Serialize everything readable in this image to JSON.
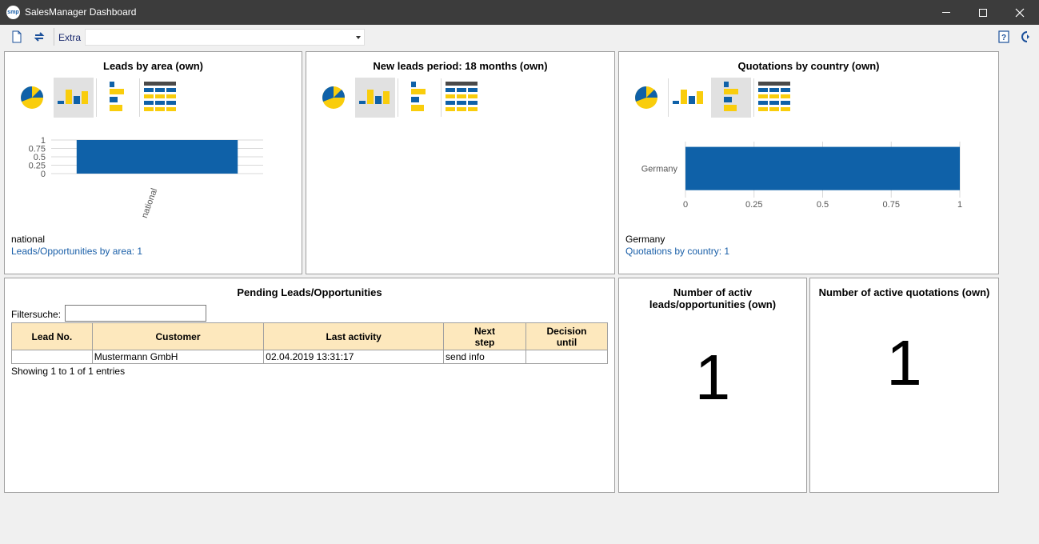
{
  "window": {
    "title": "SalesManager Dashboard",
    "app_icon_text": "smp"
  },
  "toolbar": {
    "extra_label": "Extra",
    "extra_value": ""
  },
  "panels": {
    "leads_by_area": {
      "title": "Leads by area (own)",
      "summary_label": "national",
      "summary_link": "Leads/Opportunities by area: 1"
    },
    "new_leads_period": {
      "title": "New leads period: 18 months (own)"
    },
    "quotations_by_country": {
      "title": "Quotations by country (own)",
      "summary_label": "Germany",
      "summary_link": "Quotations by country: 1"
    },
    "pending_leads": {
      "title": "Pending Leads/Opportunities",
      "filter_label": "Filtersuche:",
      "filter_value": "",
      "columns": [
        "Lead No.",
        "Customer",
        "Last activity",
        "Next step",
        "Decision until"
      ],
      "rows": [
        [
          "",
          "Mustermann GmbH",
          "02.04.2019 13:31:17",
          "send info",
          ""
        ]
      ],
      "showing": "Showing 1 to 1 of 1 entries"
    },
    "active_leads": {
      "title_line1": "Number of activ",
      "title_line2": "leads/opportunities (own)",
      "value": "1"
    },
    "active_quotations": {
      "title": "Number of active quotations (own)",
      "value": "1"
    }
  },
  "colors": {
    "blue": "#0f61a8",
    "yellow": "#f9cd0c",
    "dark": "#4a4a4a",
    "header_bg": "#fde8bd"
  },
  "chart_data": [
    {
      "type": "bar",
      "title": "Leads by area (own)",
      "categories": [
        "national"
      ],
      "values": [
        1
      ],
      "ylim": [
        0,
        1
      ],
      "yticks": [
        "1",
        "0.75",
        "0.5",
        "0.25",
        "0"
      ]
    },
    {
      "type": "bar",
      "orientation": "horizontal",
      "title": "Quotations by country (own)",
      "categories": [
        "Germany"
      ],
      "values": [
        1
      ],
      "xlim": [
        0,
        1
      ],
      "xticks": [
        "0",
        "0.25",
        "0.5",
        "0.75",
        "1"
      ]
    }
  ]
}
